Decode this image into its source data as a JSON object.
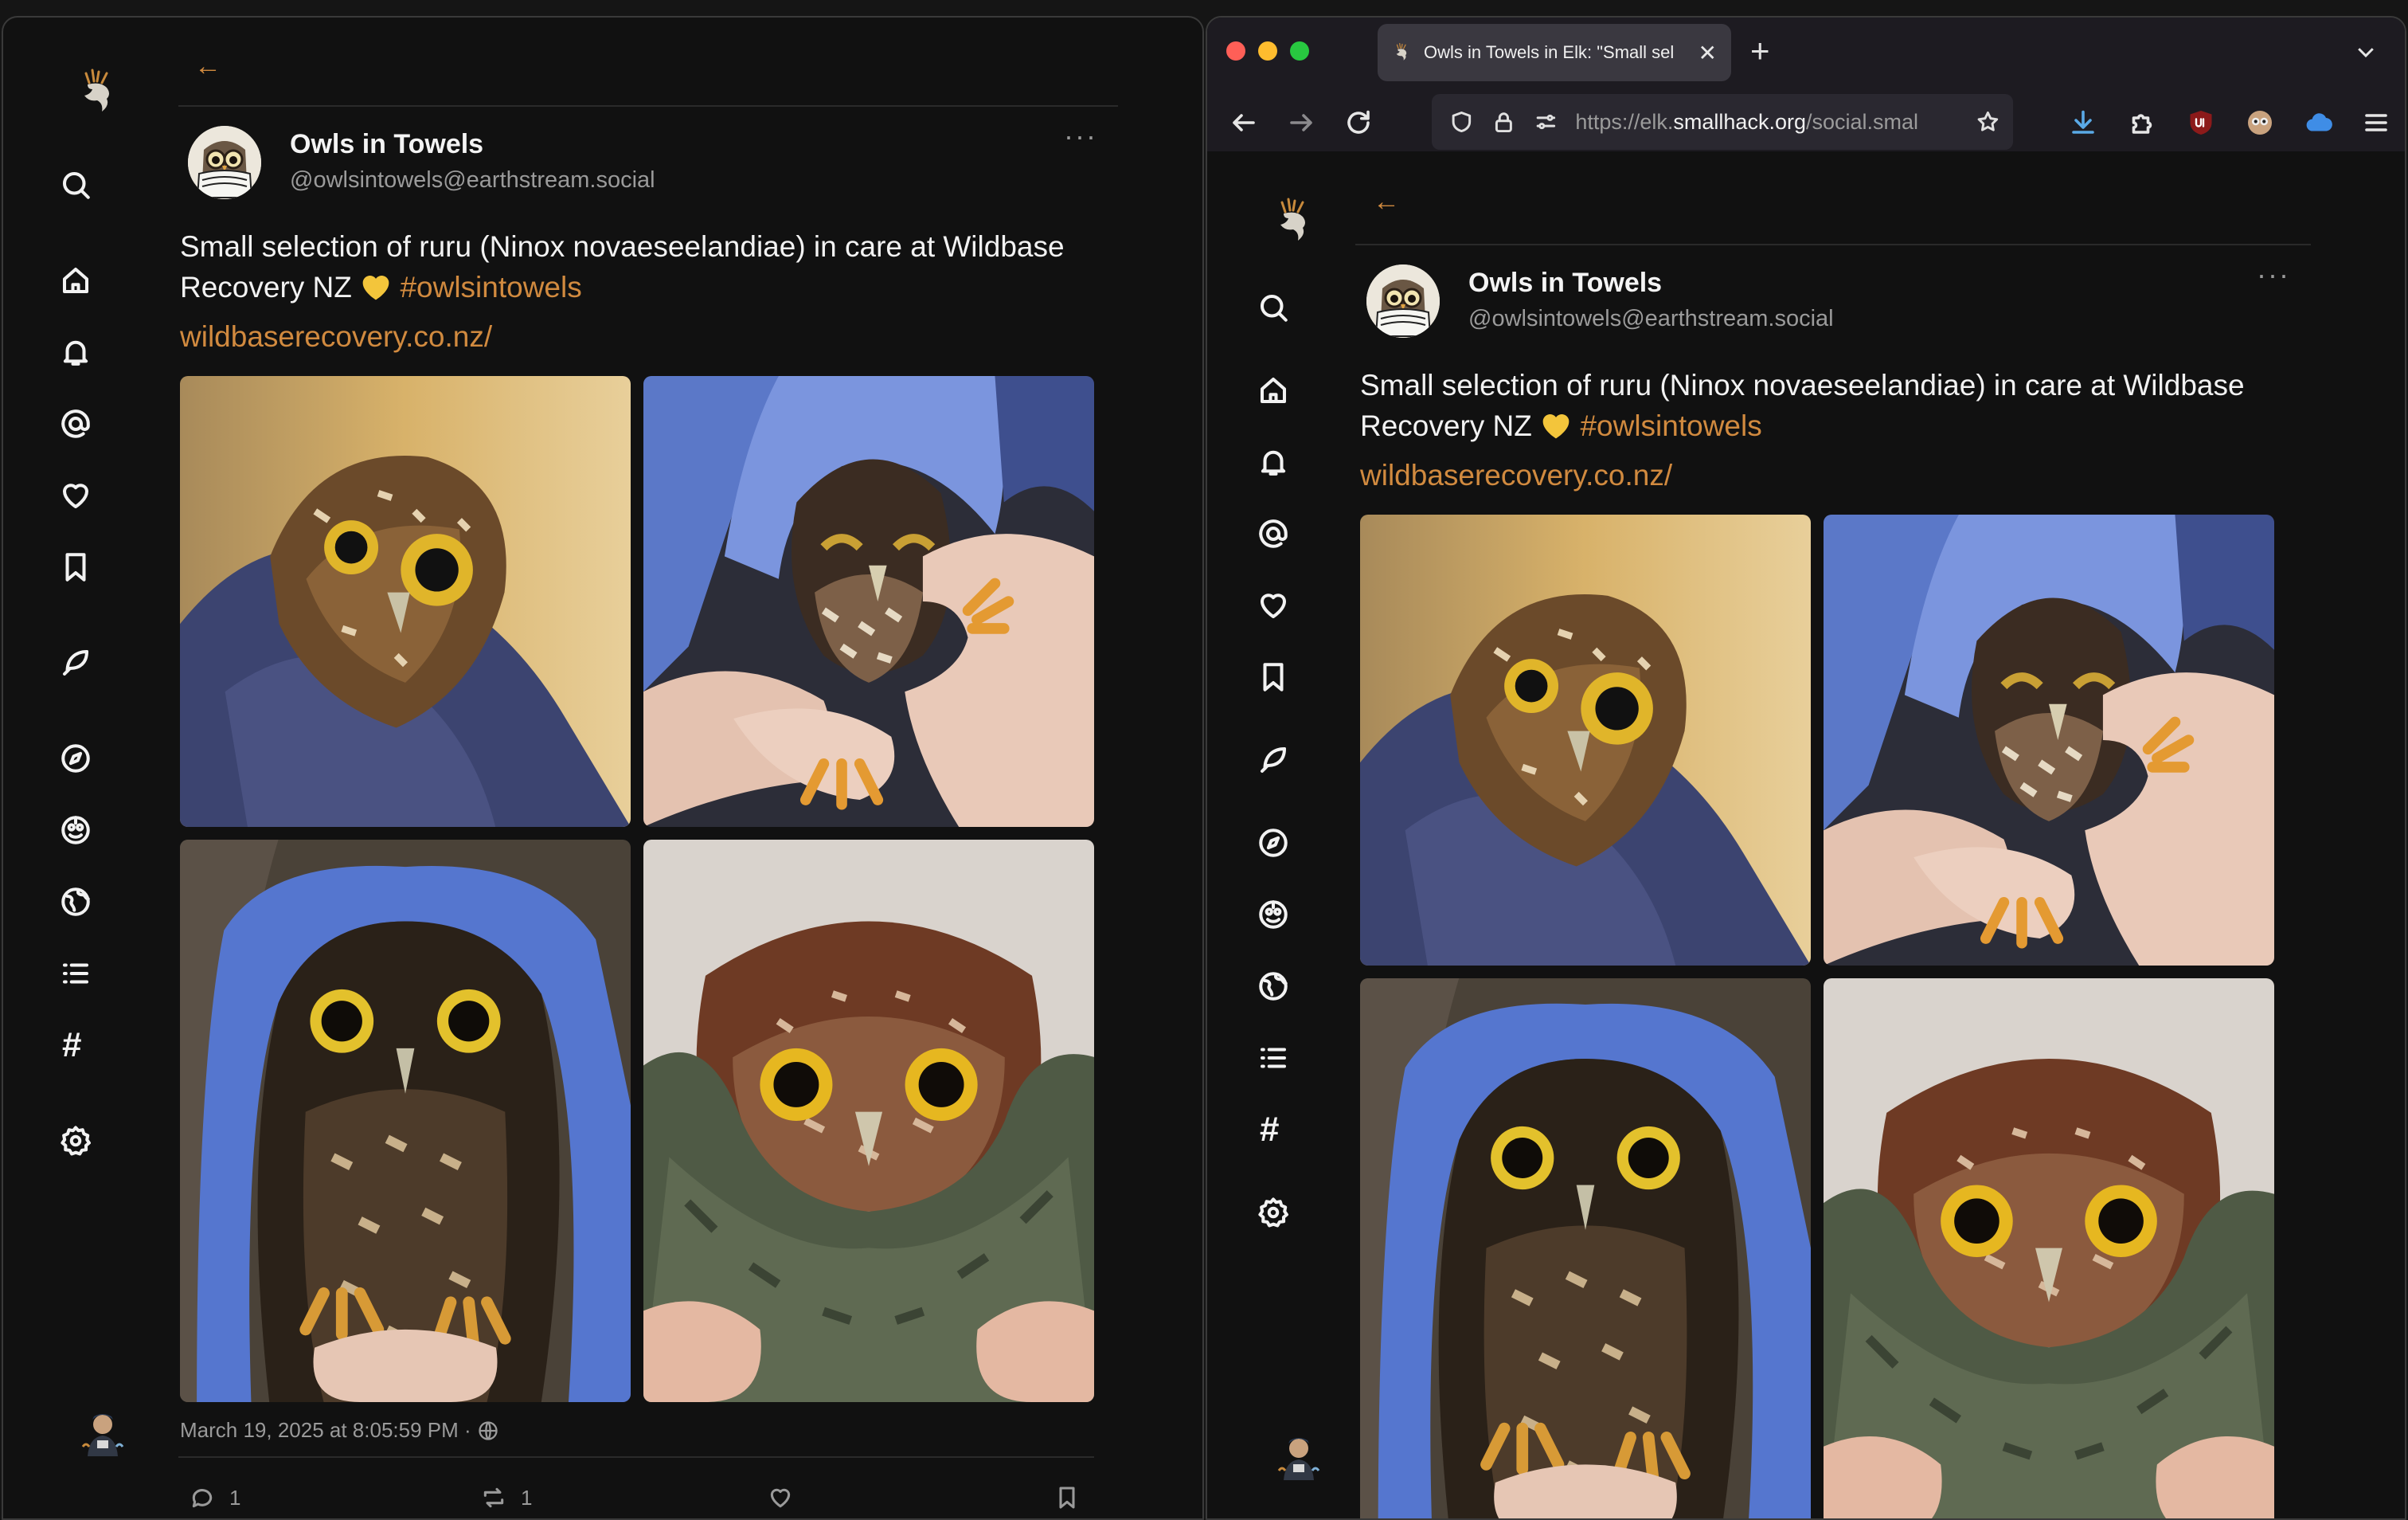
{
  "post": {
    "author_name": "Owls in Towels",
    "author_handle_user": "@owlsintowels",
    "author_handle_domain": "@earthstream.social",
    "more_label": "···",
    "text_line1": "Small selection of ruru (Ninox novaeseelandiae) in care at Wildbase",
    "text_line2": "Recovery NZ",
    "hashtag": "#owlsintowels",
    "link": "wildbaserecovery.co.nz/",
    "timestamp": "March 19, 2025 at 8:05:59 PM ·",
    "replies": "1",
    "boosts": "1"
  },
  "nav": {
    "items": [
      "search-icon",
      "home-icon",
      "notifications-icon",
      "mentions-icon",
      "favourites-icon",
      "bookmarks-icon",
      "compose-icon",
      "explore-icon",
      "local-icon",
      "federated-icon",
      "lists-icon",
      "hashtags-icon",
      "settings-icon"
    ],
    "hashtag_glyph": "#"
  },
  "browser": {
    "tab_title": "Owls in Towels in Elk: \"Small sel",
    "tab_close": "✕",
    "newtab": "+",
    "url_prefix": "https://elk.",
    "url_domain": "smallhack.org",
    "url_suffix": "/social.smal"
  },
  "colors": {
    "accent": "#d18a3f",
    "background": "#111111"
  }
}
